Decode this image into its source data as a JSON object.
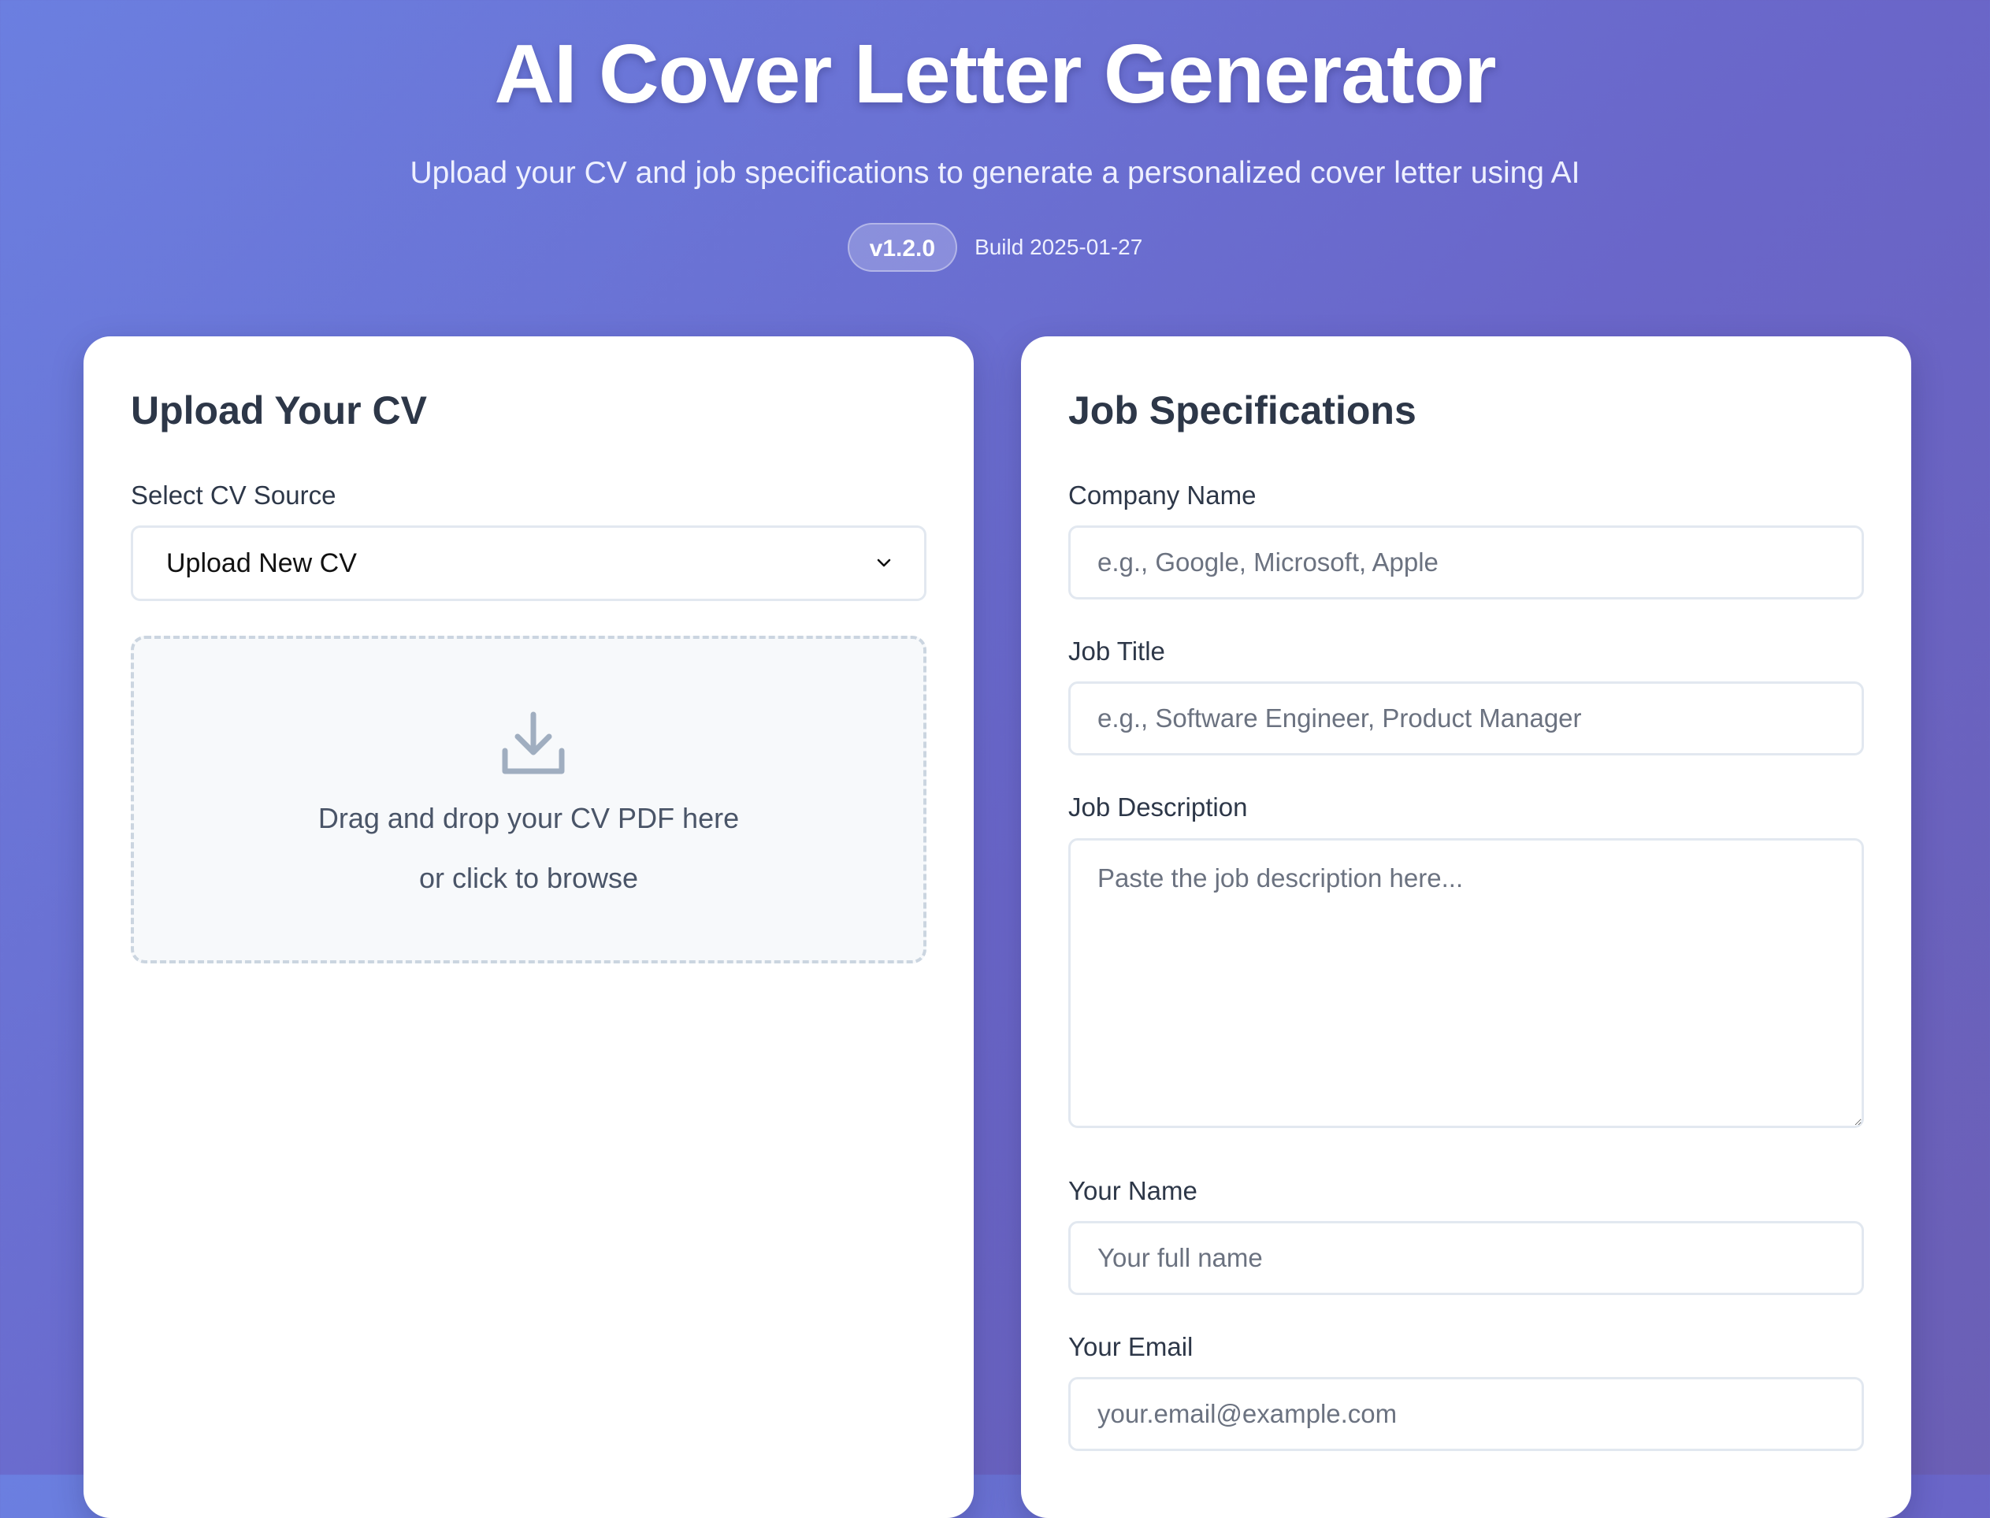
{
  "header": {
    "title": "AI Cover Letter Generator",
    "subtitle": "Upload your CV and job specifications to generate a personalized cover letter using AI",
    "version": "v1.2.0",
    "build": "Build 2025-01-27"
  },
  "cv_panel": {
    "title": "Upload Your CV",
    "source_label": "Select CV Source",
    "source_value": "Upload New CV",
    "dropzone_icon": "download-tray-icon",
    "dropzone_line1": "Drag and drop your CV PDF here",
    "dropzone_line2": "or click to browse"
  },
  "job_panel": {
    "title": "Job Specifications",
    "company_label": "Company Name",
    "company_placeholder": "e.g., Google, Microsoft, Apple",
    "job_title_label": "Job Title",
    "job_title_placeholder": "e.g., Software Engineer, Product Manager",
    "description_label": "Job Description",
    "description_placeholder": "Paste the job description here...",
    "name_label": "Your Name",
    "name_placeholder": "Your full name",
    "email_label": "Your Email",
    "email_placeholder": "your.email@example.com"
  },
  "colors": {
    "background_start": "#6b7fe0",
    "background_end": "#6b5fb5",
    "card": "#ffffff",
    "heading": "#2d3748",
    "input_border": "#e2e8f0",
    "dropzone_border": "#cbd5e0",
    "dropzone_bg": "#f7f9fb"
  }
}
